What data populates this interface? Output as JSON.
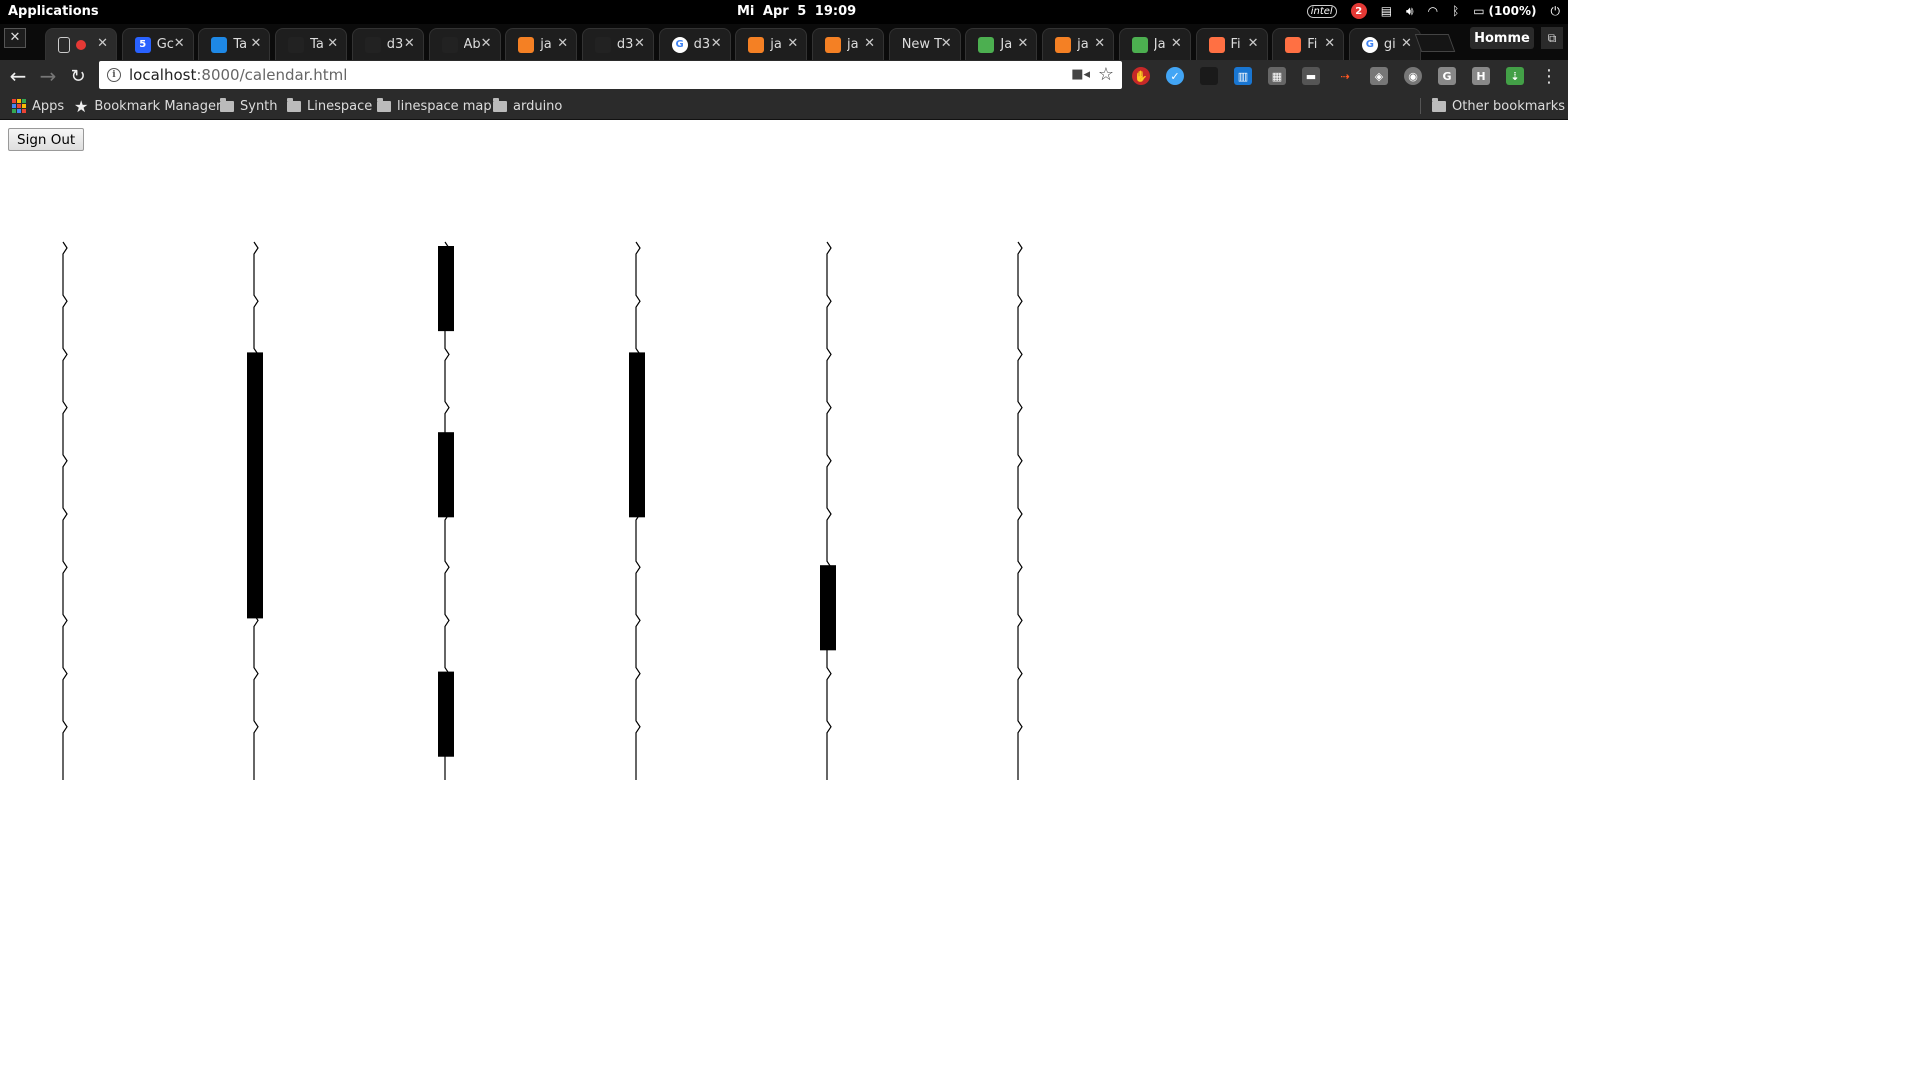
{
  "system_bar": {
    "applications_label": "Applications",
    "clock": "Mi Apr  5   19:09",
    "intel_label": "intel",
    "notification_count": "2",
    "battery": "(100%)"
  },
  "browser": {
    "tabs": [
      {
        "title": "",
        "icon": "document-icon",
        "color": "#cccccc",
        "active": true,
        "recording": true
      },
      {
        "title": "Gc",
        "icon": "google-calendar-icon",
        "color": "#2962ff",
        "badge": "5"
      },
      {
        "title": "Ta",
        "icon": "dropbox-icon",
        "color": "#1e88e5"
      },
      {
        "title": "Ta",
        "icon": "github-icon",
        "color": "#222222"
      },
      {
        "title": "d3",
        "icon": "github-icon",
        "color": "#222222"
      },
      {
        "title": "Ab",
        "icon": "github-icon",
        "color": "#222222"
      },
      {
        "title": "ja",
        "icon": "stackoverflow-icon",
        "color": "#f48024"
      },
      {
        "title": "d3",
        "icon": "github-icon",
        "color": "#222222"
      },
      {
        "title": "d3",
        "icon": "google-icon",
        "color": "#ffffff"
      },
      {
        "title": "ja",
        "icon": "stackoverflow-icon",
        "color": "#f48024"
      },
      {
        "title": "ja",
        "icon": "stackoverflow-icon",
        "color": "#f48024"
      },
      {
        "title": "New T",
        "icon": "none",
        "color": ""
      },
      {
        "title": "Ja",
        "icon": "w3schools-icon",
        "color": "#4caf50"
      },
      {
        "title": "ja",
        "icon": "stackoverflow-icon",
        "color": "#f48024"
      },
      {
        "title": "Ja",
        "icon": "w3schools-icon",
        "color": "#4caf50"
      },
      {
        "title": "Fi",
        "icon": "firebase-icon",
        "color": "#ff7043"
      },
      {
        "title": "Fi",
        "icon": "firebase-icon",
        "color": "#ff7043"
      },
      {
        "title": "gi",
        "icon": "google-icon",
        "color": "#ffffff"
      }
    ],
    "profile_name": "Homme",
    "url_host": "localhost",
    "url_path": ":8000/calendar.html",
    "bookmarks": [
      {
        "label": "Apps",
        "icon": "apps-grid-icon"
      },
      {
        "label": "Bookmark Manager",
        "icon": "star-icon"
      },
      {
        "label": "Synth",
        "icon": "folder-icon"
      },
      {
        "label": "Linespace",
        "icon": "folder-icon"
      },
      {
        "label": "linespace map",
        "icon": "folder-icon"
      },
      {
        "label": "arduino",
        "icon": "folder-icon"
      }
    ],
    "other_bookmarks": "Other bookmarks"
  },
  "page": {
    "sign_out_label": "Sign Out",
    "calendar": {
      "columns": 6,
      "slots": 10,
      "events": [
        {
          "column": 1,
          "start": 2,
          "end": 7
        },
        {
          "column": 2,
          "start": 0,
          "end": 1.6
        },
        {
          "column": 2,
          "start": 3.5,
          "end": 5.1
        },
        {
          "column": 2,
          "start": 8,
          "end": 9.6
        },
        {
          "column": 3,
          "start": 2,
          "end": 5.1
        },
        {
          "column": 4,
          "start": 6,
          "end": 7.6
        }
      ],
      "event_color": "#000000",
      "line_color": "#000000"
    }
  }
}
